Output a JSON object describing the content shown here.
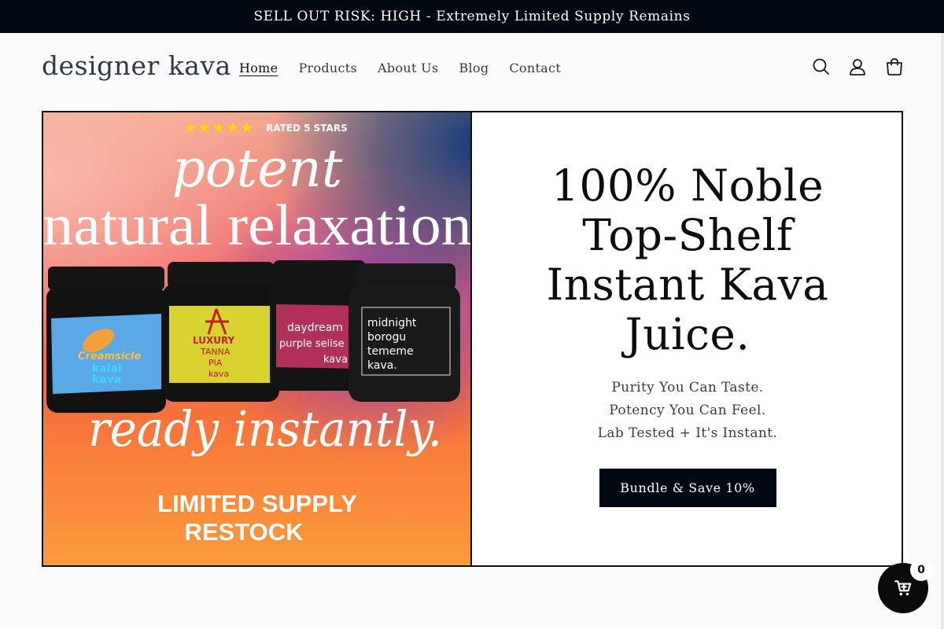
{
  "announcement": "SELL OUT RISK: HIGH - Extremely Limited Supply Remains",
  "header": {
    "logo": "designer kava",
    "nav": [
      {
        "label": "Home",
        "active": true
      },
      {
        "label": "Products",
        "active": false
      },
      {
        "label": "About Us",
        "active": false
      },
      {
        "label": "Blog",
        "active": false
      },
      {
        "label": "Contact",
        "active": false
      }
    ],
    "icons": [
      "search-icon",
      "account-icon",
      "cart-icon"
    ]
  },
  "hero": {
    "image": {
      "rating_stars": "★★★★★",
      "rating_text": "RATED 5 STARS",
      "headline_top": "potent",
      "headline_mid": "natural relaxation",
      "headline_bottom": "ready instantly.",
      "restock_line1": "LIMITED SUPPLY",
      "restock_line2": "RESTOCK",
      "jars": [
        {
          "brand": "Creamsicle",
          "line2": "kalai",
          "line3": "kava",
          "label_color": "#5aa9e6"
        },
        {
          "brand": "LUXURY",
          "line2": "TANNA",
          "line3": "PIA",
          "line4": "kava",
          "label_color": "#d9d332"
        },
        {
          "brand": "daydream",
          "line2": "purple selise",
          "line3": "kava",
          "label_color": "#b0305a"
        },
        {
          "brand": "midnight",
          "line2": "borogu",
          "line3": "tememe",
          "line4": "kava.",
          "label_color": "#1a1a1a"
        }
      ]
    },
    "title_lines": [
      "100% Noble",
      "Top-Shelf",
      "Instant Kava",
      "Juice."
    ],
    "sub_lines": [
      "Purity You Can Taste.",
      "Potency You Can Feel.",
      "Lab Tested + It's Instant."
    ],
    "button": "Bundle & Save 10%"
  },
  "cart": {
    "count": "0"
  },
  "colors": {
    "announcement_bg": "#020812",
    "button_bg": "#020812"
  }
}
